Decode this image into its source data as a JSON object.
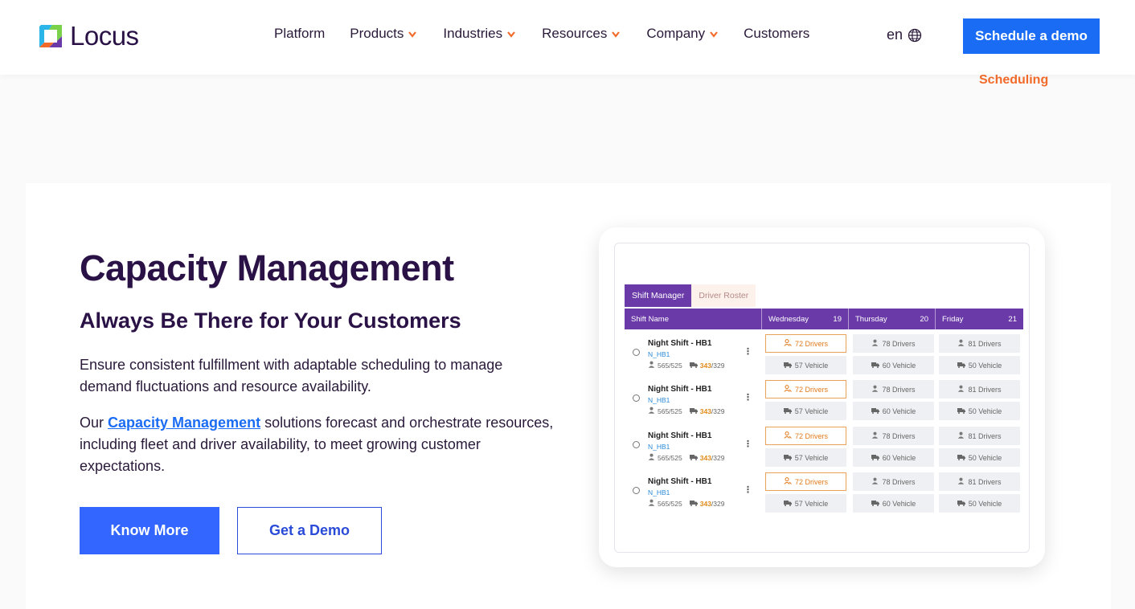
{
  "header": {
    "logo_text": "Locus",
    "nav": [
      {
        "label": "Platform",
        "dropdown": false
      },
      {
        "label": "Products",
        "dropdown": true
      },
      {
        "label": "Industries",
        "dropdown": true
      },
      {
        "label": "Resources",
        "dropdown": true
      },
      {
        "label": "Company",
        "dropdown": true
      },
      {
        "label": "Customers",
        "dropdown": false
      }
    ],
    "lang": "en",
    "cta": "Schedule a demo",
    "sub_link": "Scheduling",
    "accent_color": "#1a6cf5",
    "chevron_color": "#f26b2a"
  },
  "hero": {
    "title": "Capacity Management",
    "subtitle": "Always Be There for Your Customers",
    "para1": "Ensure consistent fulfillment with adaptable scheduling to manage demand fluctuations and resource availability.",
    "para2_prefix": "Our ",
    "para2_link": "Capacity Management",
    "para2_suffix": " solutions forecast and orchestrate resources, including fleet and driver availability, to meet growing customer expectations.",
    "btn_primary": "Know More",
    "btn_secondary": "Get a Demo"
  },
  "app": {
    "tabs": [
      "Shift Manager",
      "Driver Roster"
    ],
    "columns": [
      {
        "label": "Shift Name",
        "num": ""
      },
      {
        "label": "Wednesday",
        "num": "19"
      },
      {
        "label": "Thursday",
        "num": "20"
      },
      {
        "label": "Friday",
        "num": "21"
      }
    ],
    "rows": [
      {
        "name": "Night Shift - HB1",
        "code": "N_HB1",
        "drivers_stat": "565/525",
        "vehicle_stat_hi": "343",
        "vehicle_stat": "/329"
      },
      {
        "name": "Night Shift - HB1",
        "code": "N_HB1",
        "drivers_stat": "565/525",
        "vehicle_stat_hi": "343",
        "vehicle_stat": "/329"
      },
      {
        "name": "Night Shift - HB1",
        "code": "N_HB1",
        "drivers_stat": "565/525",
        "vehicle_stat_hi": "343",
        "vehicle_stat": "/329"
      },
      {
        "name": "Night Shift - HB1",
        "code": "N_HB1",
        "drivers_stat": "565/525",
        "vehicle_stat_hi": "343",
        "vehicle_stat": "/329"
      }
    ],
    "days": [
      {
        "drivers": "72 Drivers",
        "vehicles": "57 Vehicle",
        "highlight": true
      },
      {
        "drivers": "78 Drivers",
        "vehicles": "60 Vehicle",
        "highlight": false
      },
      {
        "drivers": "81 Drivers",
        "vehicles": "50 Vehicle",
        "highlight": false
      }
    ]
  }
}
